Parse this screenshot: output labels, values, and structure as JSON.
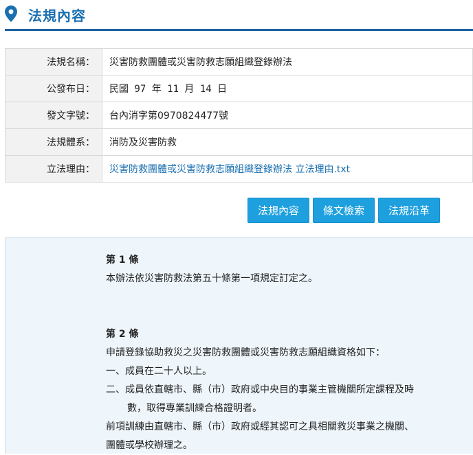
{
  "header": {
    "title": "法規內容",
    "icon": "map-pin-icon"
  },
  "info": {
    "rows": [
      {
        "label": "法規名稱：",
        "value": "災害防救團體或災害防救志願組織登錄辦法"
      },
      {
        "label": "公發布日：",
        "value": "民國 97 年 11 月 14 日"
      },
      {
        "label": "發文字號：",
        "value": "台內消字第0970824477號"
      },
      {
        "label": "法規體系：",
        "value": "消防及災害防救"
      },
      {
        "label": "立法理由：",
        "value": "災害防救團體或災害防救志願組織登錄辦法 立法理由.txt"
      }
    ]
  },
  "buttons": {
    "content": "法規內容",
    "search": "條文檢索",
    "history": "法規沿革"
  },
  "articles": [
    {
      "no": "第 1 條",
      "lines": [
        "本辦法依災害防救法第五十條第一項規定訂定之。"
      ]
    },
    {
      "no": "第 2 條",
      "lines": [
        "申請登錄協助救災之災害防救團體或災害防救志願組織資格如下：",
        "一、成員在二十人以上。",
        "二、成員依直轄市、縣（市）政府或中央目的事業主管機關所定課程及時",
        "數，取得專業訓練合格證明者。",
        "前項訓練由直轄市、縣（市）政府或經其認可之具相關救災事業之機關、",
        "團體或學校辦理之。"
      ]
    }
  ],
  "colors": {
    "accent": "#1a6fb0",
    "button": "#1ea0df",
    "panel": "#eef5fb"
  }
}
